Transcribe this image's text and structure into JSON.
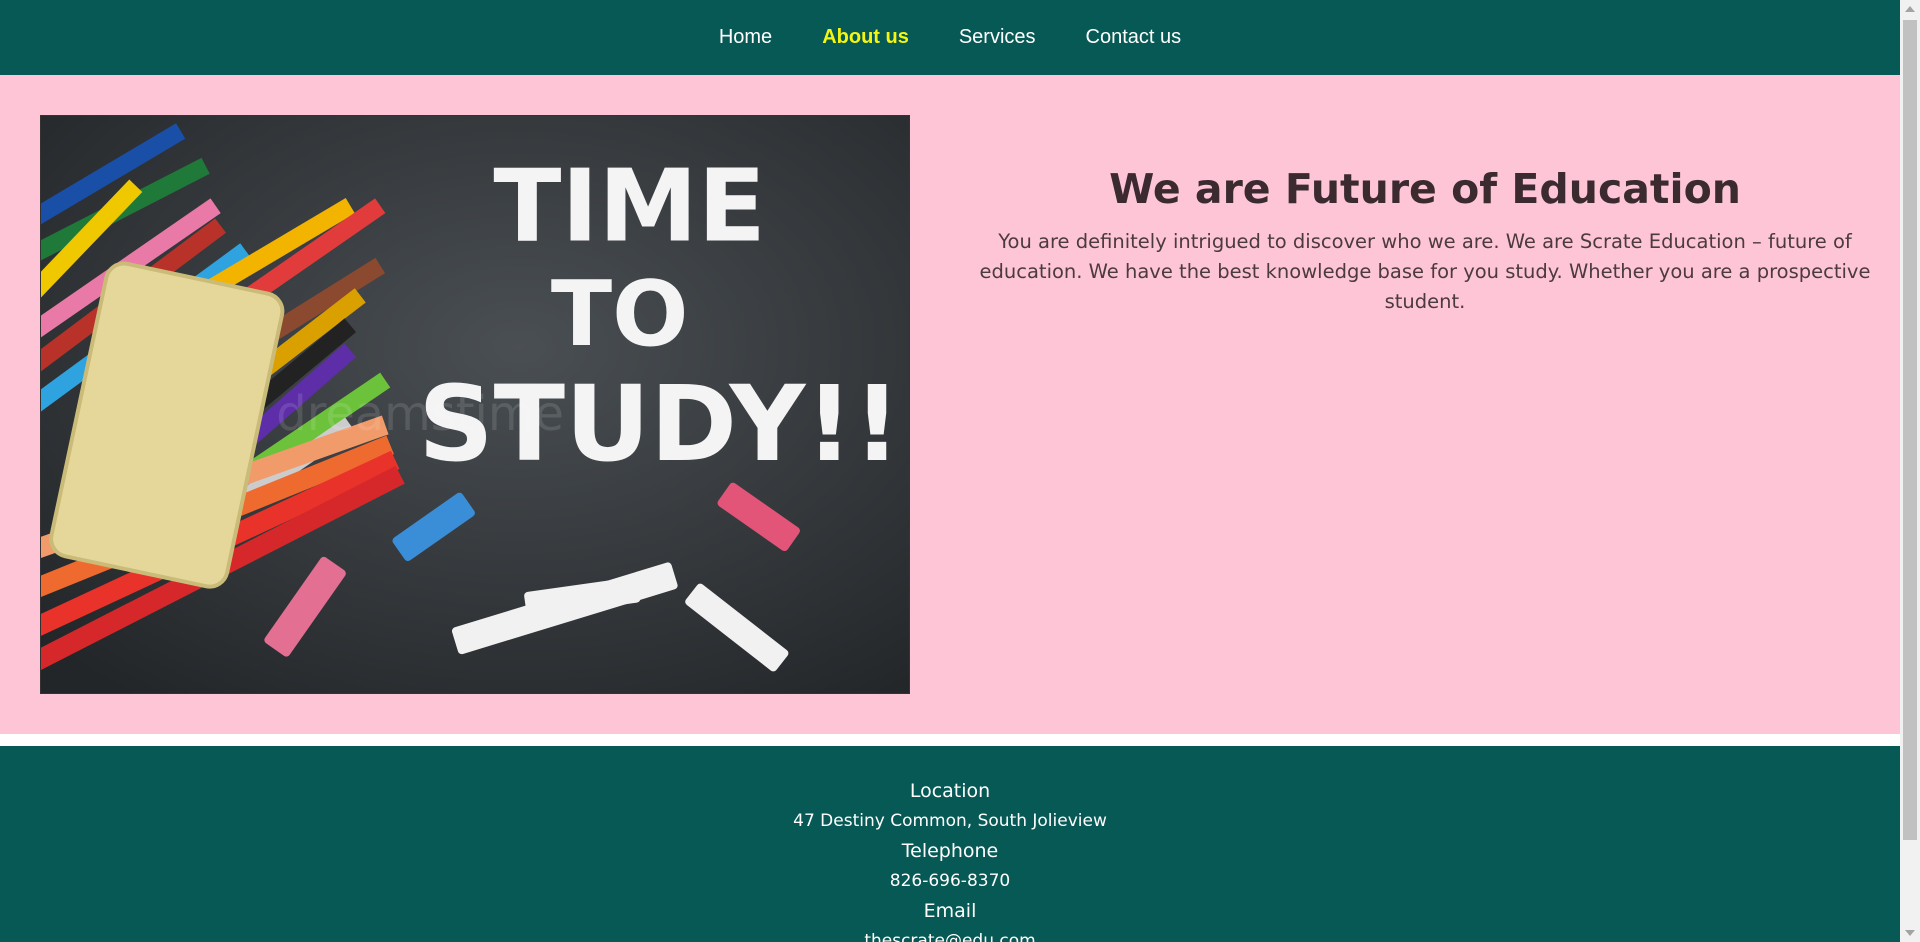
{
  "nav": {
    "items": [
      {
        "label": "Home",
        "active": false
      },
      {
        "label": "About us",
        "active": true
      },
      {
        "label": "Services",
        "active": false
      },
      {
        "label": "Contact us",
        "active": false
      }
    ]
  },
  "hero": {
    "image": {
      "description_icon": "chalkboard-photo",
      "headline_line1": "TIME",
      "headline_line2": "TO",
      "headline_line3": "STUDY!!",
      "watermark": "dreamstime"
    },
    "title": "We are Future of Education",
    "text": "You are definitely intrigued to discover who we are. We are Scrate Education – future of education. We have the best knowledge base for you study. Whether you are a prospective student."
  },
  "footer": {
    "location_label": "Location",
    "location_value": "47 Destiny Common, South Jolieview",
    "telephone_label": "Telephone",
    "telephone_value": "826-696-8370",
    "email_label": "Email",
    "email_value": "thescrate@edu.com"
  },
  "colors": {
    "nav_bg": "#075955",
    "active_link": "#f5f510",
    "hero_bg": "#fec5d6",
    "footer_bg": "#075955"
  }
}
